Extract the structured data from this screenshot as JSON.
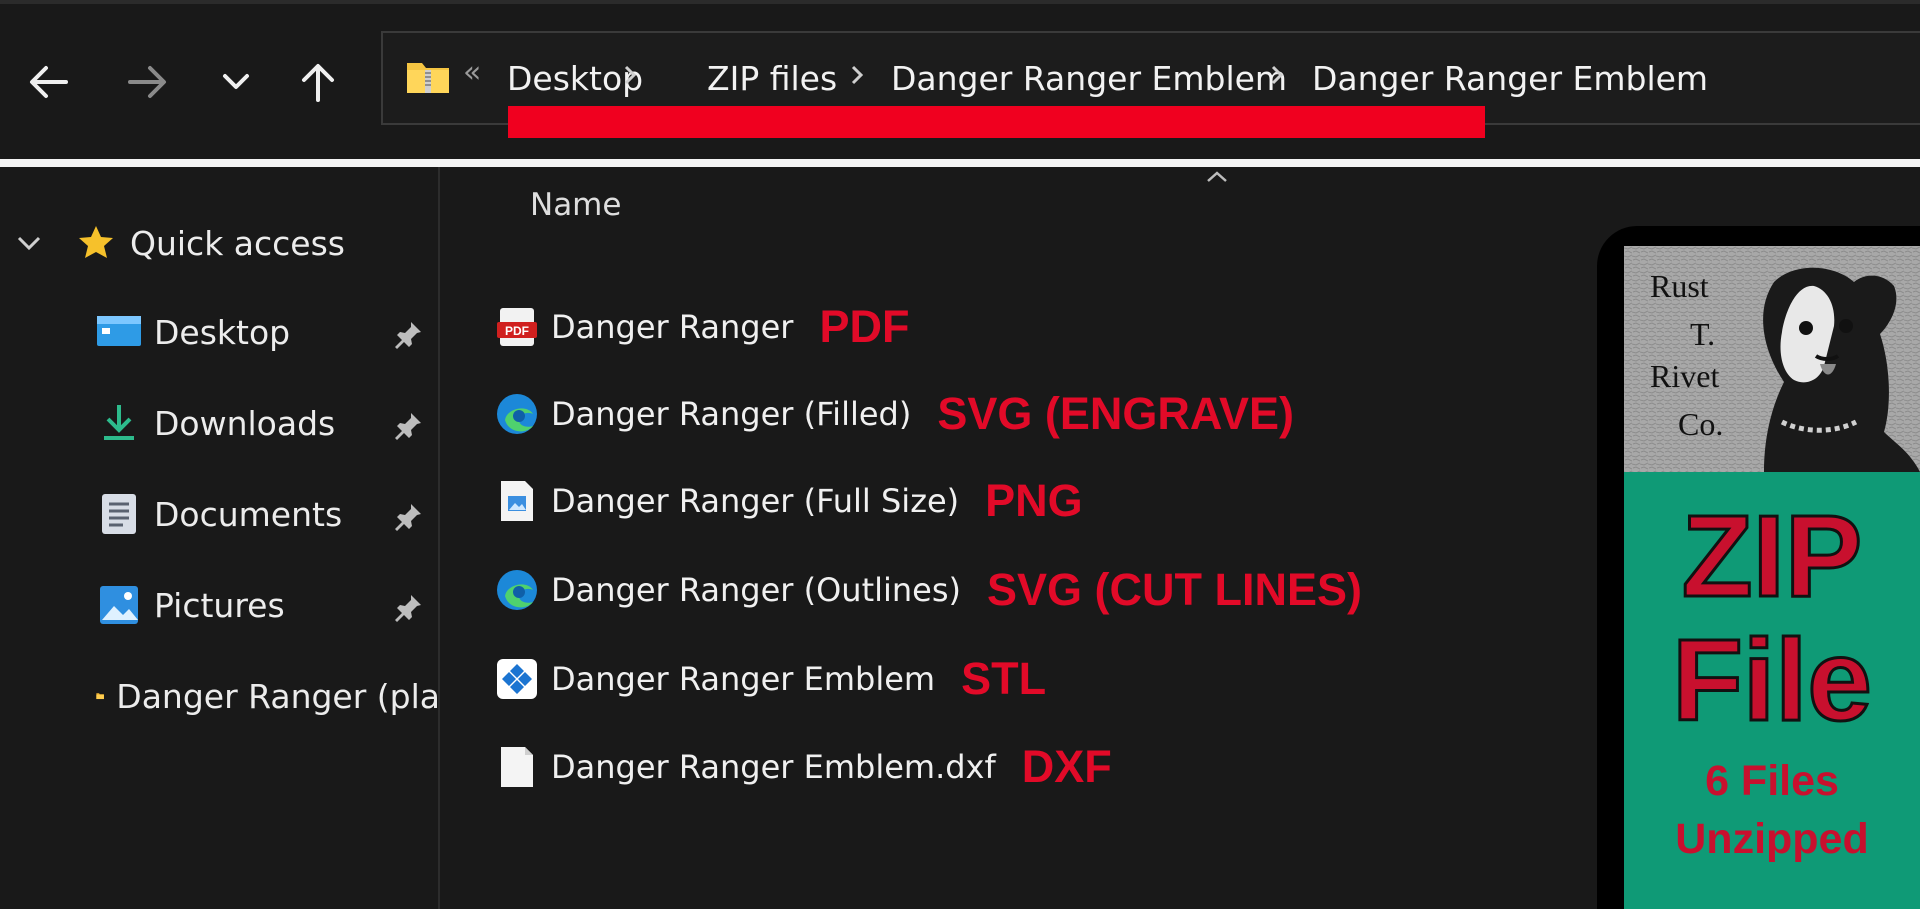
{
  "navigation": {
    "back_icon": "arrow-left-icon",
    "forward_icon": "arrow-right-icon",
    "recent_icon": "chevron-down-icon",
    "up_icon": "arrow-up-icon"
  },
  "address_bar": {
    "overflow": "«",
    "crumbs": [
      "Desktop",
      "ZIP files",
      "Danger Ranger Emblem",
      "Danger Ranger Emblem"
    ],
    "highlight_color": "#f0001f"
  },
  "sidebar": {
    "quick_access": "Quick access",
    "items": [
      {
        "label": "Desktop",
        "icon": "desktop-icon",
        "pinned": true
      },
      {
        "label": "Downloads",
        "icon": "download-icon",
        "pinned": true
      },
      {
        "label": "Documents",
        "icon": "documents-icon",
        "pinned": true
      },
      {
        "label": "Pictures",
        "icon": "pictures-icon",
        "pinned": true
      },
      {
        "label": "Danger Ranger (pla",
        "icon": "folder-icon",
        "pinned": false
      }
    ]
  },
  "file_list": {
    "column_name": "Name",
    "files": [
      {
        "name": "Danger Ranger",
        "icon": "pdf-icon",
        "tag": "PDF"
      },
      {
        "name": "Danger Ranger (Filled)",
        "icon": "edge-icon",
        "tag": "SVG (ENGRAVE)"
      },
      {
        "name": "Danger Ranger (Full Size)",
        "icon": "image-file-icon",
        "tag": "PNG"
      },
      {
        "name": "Danger Ranger (Outlines)",
        "icon": "edge-icon",
        "tag": "SVG (CUT LINES)"
      },
      {
        "name": "Danger Ranger Emblem",
        "icon": "3d-viewer-icon",
        "tag": "STL"
      },
      {
        "name": "Danger Ranger Emblem.dxf",
        "icon": "blank-file-icon",
        "tag": "DXF"
      }
    ],
    "tag_color": "#e20a28"
  },
  "promo": {
    "logo_lines": [
      "Rust",
      "T.",
      "Rivet",
      "Co."
    ],
    "zip_line1": "ZIP",
    "zip_line2": "File",
    "count_line": "6 Files",
    "status_line": "Unzipped",
    "bg_color": "#0f9a76",
    "text_color": "#c8102e"
  }
}
